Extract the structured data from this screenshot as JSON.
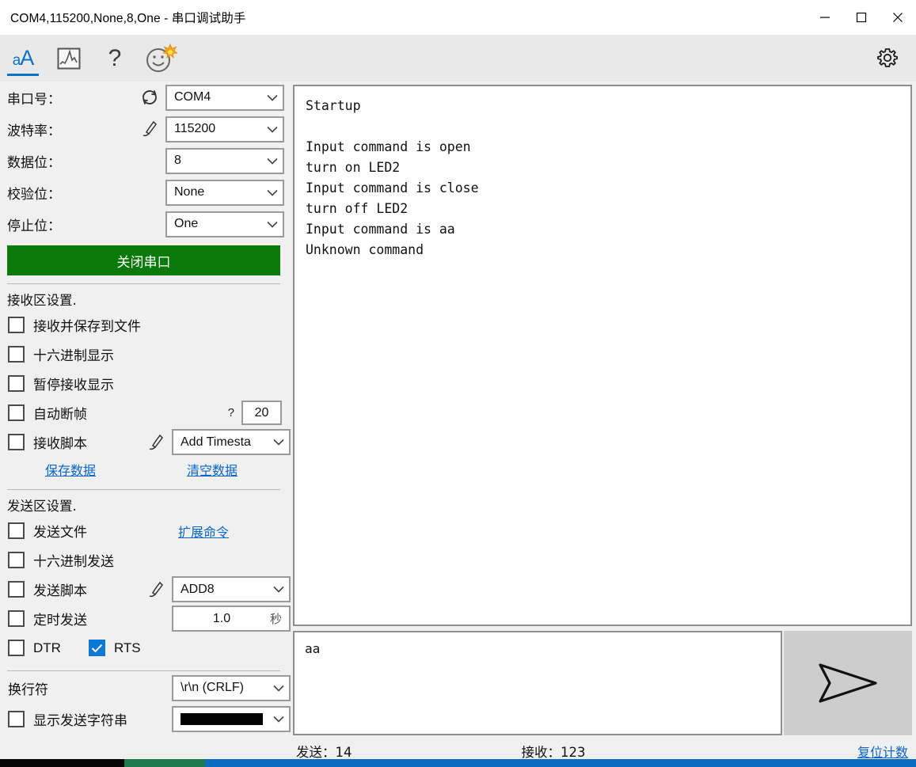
{
  "window": {
    "title": "COM4,115200,None,8,One - 串口调试助手",
    "minimize_label": "—",
    "maximize_label": "□",
    "close_label": "✕"
  },
  "toolbar": {
    "items": [
      {
        "name": "text-mode",
        "label": "aA",
        "icon": "text-aa-icon",
        "active": true
      },
      {
        "name": "waveform-mode",
        "label": "",
        "icon": "waveform-icon",
        "active": false
      },
      {
        "name": "help",
        "label": "?",
        "icon": "question-mark-icon",
        "active": false
      },
      {
        "name": "emoji",
        "label": "",
        "icon": "smiley-sparkle-icon",
        "active": false
      }
    ],
    "settings_icon": "gear-icon"
  },
  "sidebar": {
    "port": {
      "label": "串口号：",
      "value": "COM4",
      "refresh_icon": "refresh-icon"
    },
    "baud": {
      "label": "波特率：",
      "value": "115200",
      "edit_icon": "pen-icon"
    },
    "databits": {
      "label": "数据位：",
      "value": "8"
    },
    "parity": {
      "label": "校验位：",
      "value": "None"
    },
    "stopbits": {
      "label": "停止位：",
      "value": "One"
    },
    "open_close_button": {
      "label": "关闭串口",
      "color": "#097a09"
    },
    "recv_section": {
      "title": "接收区设置.",
      "save_to_file": {
        "label": "接收并保存到文件",
        "checked": false
      },
      "hex_display": {
        "label": "十六进制显示",
        "checked": false
      },
      "pause_display": {
        "label": "暂停接收显示",
        "checked": false
      },
      "auto_frame": {
        "label": "自动断帧",
        "checked": false,
        "hint": "?",
        "value": "20"
      },
      "recv_script": {
        "label": "接收脚本",
        "checked": false,
        "edit_icon": "pen-icon",
        "value": "Add Timesta"
      },
      "save_data_link": "保存数据",
      "clear_data_link": "清空数据"
    },
    "send_section": {
      "title": "发送区设置.",
      "send_file": {
        "label": "发送文件",
        "checked": false
      },
      "extend_cmd_link": "扩展命令",
      "hex_send": {
        "label": "十六进制发送",
        "checked": false
      },
      "send_script": {
        "label": "发送脚本",
        "checked": false,
        "edit_icon": "pen-icon",
        "value": "ADD8"
      },
      "timed_send": {
        "label": "定时发送",
        "checked": false,
        "value": "1.0",
        "unit": "秒"
      },
      "dtr": {
        "label": "DTR",
        "checked": false
      },
      "rts": {
        "label": "RTS",
        "checked": true,
        "color": "#0a78d4"
      }
    },
    "newline": {
      "label": "换行符",
      "value": "\\r\\n (CRLF)"
    },
    "show_send_string": {
      "label": "显示发送字符串",
      "checked": false,
      "color": "#000000"
    }
  },
  "receive_area": {
    "text": "Startup\n\nInput command is open\nturn on LED2\nInput command is close\nturn off LED2\nInput command is aa\nUnknown command"
  },
  "send_area": {
    "text": "aa",
    "send_button_icon": "send-arrow-icon"
  },
  "statusbar": {
    "sent": "发送：14",
    "received": "接收：123",
    "reset_link": "复位计数"
  }
}
